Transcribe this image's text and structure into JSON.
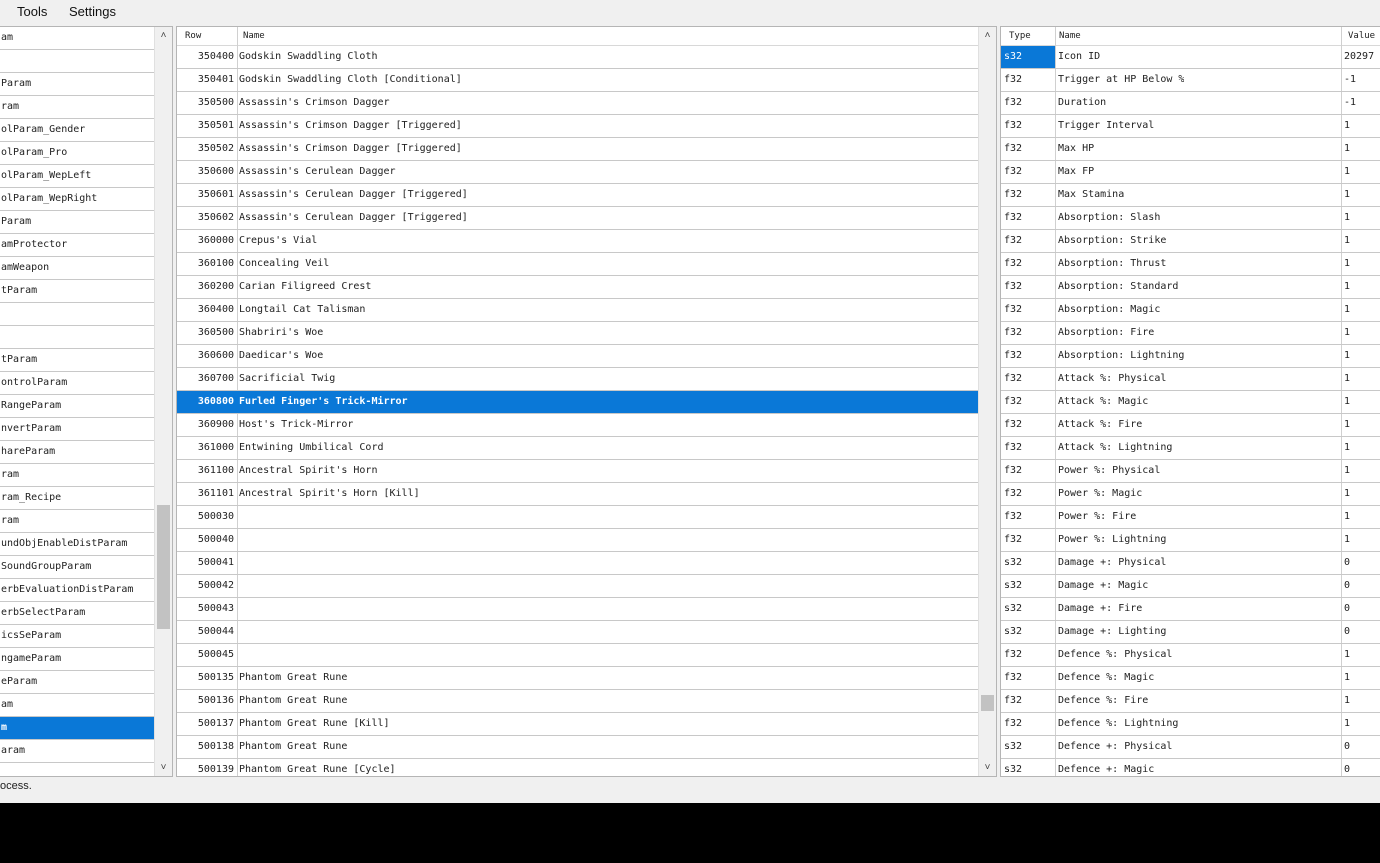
{
  "menu": {
    "tools": "Tools",
    "settings": "Settings"
  },
  "left_panel": {
    "items": [
      "am",
      "",
      "Param",
      "ram",
      "olParam_Gender",
      "olParam_Pro",
      "olParam_WepLeft",
      "olParam_WepRight",
      "Param",
      "amProtector",
      "amWeapon",
      "tParam",
      "",
      "",
      "tParam",
      "ontrolParam",
      "RangeParam",
      "nvertParam",
      "hareParam",
      "ram",
      "ram_Recipe",
      "ram",
      "undObjEnableDistParam",
      "SoundGroupParam",
      "erbEvaluationDistParam",
      "erbSelectParam",
      "icsSeParam",
      "ngameParam",
      "eParam",
      "am",
      "m",
      "aram"
    ],
    "selected_index": 30
  },
  "middle_panel": {
    "headers": {
      "row": "Row",
      "name": "Name"
    },
    "rows": [
      {
        "id": "350400",
        "name": "Godskin Swaddling Cloth"
      },
      {
        "id": "350401",
        "name": "Godskin Swaddling Cloth [Conditional]"
      },
      {
        "id": "350500",
        "name": "Assassin's Crimson Dagger"
      },
      {
        "id": "350501",
        "name": "Assassin's Crimson Dagger [Triggered]"
      },
      {
        "id": "350502",
        "name": "Assassin's Crimson Dagger [Triggered]"
      },
      {
        "id": "350600",
        "name": "Assassin's Cerulean Dagger"
      },
      {
        "id": "350601",
        "name": "Assassin's Cerulean Dagger [Triggered]"
      },
      {
        "id": "350602",
        "name": "Assassin's Cerulean Dagger [Triggered]"
      },
      {
        "id": "360000",
        "name": "Crepus's Vial"
      },
      {
        "id": "360100",
        "name": "Concealing Veil"
      },
      {
        "id": "360200",
        "name": "Carian Filigreed Crest"
      },
      {
        "id": "360400",
        "name": "Longtail Cat Talisman"
      },
      {
        "id": "360500",
        "name": "Shabriri's Woe"
      },
      {
        "id": "360600",
        "name": "Daedicar's Woe"
      },
      {
        "id": "360700",
        "name": "Sacrificial Twig"
      },
      {
        "id": "360800",
        "name": "Furled Finger's Trick-Mirror"
      },
      {
        "id": "360900",
        "name": "Host's Trick-Mirror"
      },
      {
        "id": "361000",
        "name": "Entwining Umbilical Cord"
      },
      {
        "id": "361100",
        "name": "Ancestral Spirit's Horn"
      },
      {
        "id": "361101",
        "name": "Ancestral Spirit's Horn [Kill]"
      },
      {
        "id": "500030",
        "name": ""
      },
      {
        "id": "500040",
        "name": ""
      },
      {
        "id": "500041",
        "name": ""
      },
      {
        "id": "500042",
        "name": ""
      },
      {
        "id": "500043",
        "name": ""
      },
      {
        "id": "500044",
        "name": ""
      },
      {
        "id": "500045",
        "name": ""
      },
      {
        "id": "500135",
        "name": "Phantom Great Rune"
      },
      {
        "id": "500136",
        "name": "Phantom Great Rune"
      },
      {
        "id": "500137",
        "name": "Phantom Great Rune [Kill]"
      },
      {
        "id": "500138",
        "name": "Phantom Great Rune"
      },
      {
        "id": "500139",
        "name": "Phantom Great Rune [Cycle]"
      }
    ],
    "selected_index": 15
  },
  "right_panel": {
    "headers": {
      "type": "Type",
      "name": "Name",
      "value": "Value"
    },
    "rows": [
      {
        "type": "s32",
        "name": "Icon ID",
        "value": "20297"
      },
      {
        "type": "f32",
        "name": "Trigger at HP Below %",
        "value": "-1"
      },
      {
        "type": "f32",
        "name": "Duration",
        "value": "-1"
      },
      {
        "type": "f32",
        "name": "Trigger Interval",
        "value": "1"
      },
      {
        "type": "f32",
        "name": "Max HP",
        "value": "1"
      },
      {
        "type": "f32",
        "name": "Max FP",
        "value": "1"
      },
      {
        "type": "f32",
        "name": "Max Stamina",
        "value": "1"
      },
      {
        "type": "f32",
        "name": "Absorption: Slash",
        "value": "1"
      },
      {
        "type": "f32",
        "name": "Absorption: Strike",
        "value": "1"
      },
      {
        "type": "f32",
        "name": "Absorption: Thrust",
        "value": "1"
      },
      {
        "type": "f32",
        "name": "Absorption: Standard",
        "value": "1"
      },
      {
        "type": "f32",
        "name": "Absorption: Magic",
        "value": "1"
      },
      {
        "type": "f32",
        "name": "Absorption: Fire",
        "value": "1"
      },
      {
        "type": "f32",
        "name": "Absorption: Lightning",
        "value": "1"
      },
      {
        "type": "f32",
        "name": "Attack %: Physical",
        "value": "1"
      },
      {
        "type": "f32",
        "name": "Attack %: Magic",
        "value": "1"
      },
      {
        "type": "f32",
        "name": "Attack %: Fire",
        "value": "1"
      },
      {
        "type": "f32",
        "name": "Attack %: Lightning",
        "value": "1"
      },
      {
        "type": "f32",
        "name": "Power %: Physical",
        "value": "1"
      },
      {
        "type": "f32",
        "name": "Power %: Magic",
        "value": "1"
      },
      {
        "type": "f32",
        "name": "Power %: Fire",
        "value": "1"
      },
      {
        "type": "f32",
        "name": "Power %: Lightning",
        "value": "1"
      },
      {
        "type": "s32",
        "name": "Damage +: Physical",
        "value": "0"
      },
      {
        "type": "s32",
        "name": "Damage +: Magic",
        "value": "0"
      },
      {
        "type": "s32",
        "name": "Damage +: Fire",
        "value": "0"
      },
      {
        "type": "s32",
        "name": "Damage +: Lighting",
        "value": "0"
      },
      {
        "type": "f32",
        "name": "Defence %: Physical",
        "value": "1"
      },
      {
        "type": "f32",
        "name": "Defence %: Magic",
        "value": "1"
      },
      {
        "type": "f32",
        "name": "Defence %: Fire",
        "value": "1"
      },
      {
        "type": "f32",
        "name": "Defence %: Lightning",
        "value": "1"
      },
      {
        "type": "s32",
        "name": "Defence +: Physical",
        "value": "0"
      },
      {
        "type": "s32",
        "name": "Defence +: Magic",
        "value": "0"
      }
    ]
  },
  "status_text": "ocess.",
  "colors": {
    "selection": "#0a78d7",
    "background": "#f0f0f0",
    "panel": "#ffffff"
  },
  "icons": {
    "scroll_up": "chevron-up-icon",
    "scroll_down": "chevron-down-icon"
  }
}
